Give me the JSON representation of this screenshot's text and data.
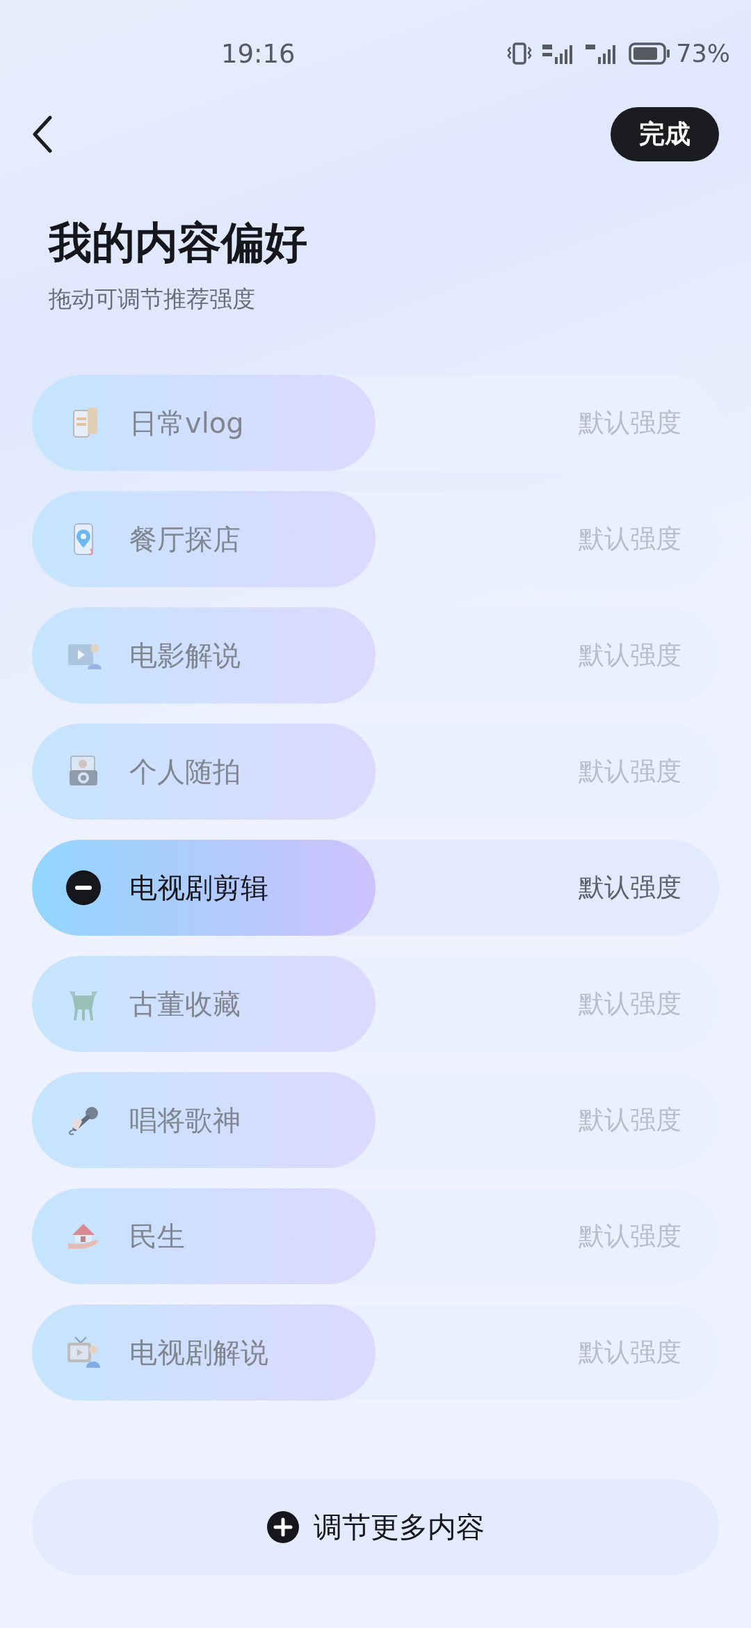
{
  "status_bar": {
    "time": "19:16",
    "battery": "73%"
  },
  "header": {
    "done_button": "完成"
  },
  "title": "我的内容偏好",
  "subtitle": "拖动可调节推荐强度",
  "items": [
    {
      "label": "日常vlog",
      "reading": "默认强度",
      "level": 0.5,
      "selected": false,
      "kind": "phone"
    },
    {
      "label": "餐厅探店",
      "reading": "默认强度",
      "level": 0.5,
      "selected": false,
      "kind": "pin"
    },
    {
      "label": "电影解说",
      "reading": "默认强度",
      "level": 0.5,
      "selected": false,
      "kind": "film"
    },
    {
      "label": "个人随拍",
      "reading": "默认强度",
      "level": 0.5,
      "selected": false,
      "kind": "camera"
    },
    {
      "label": "电视剧剪辑",
      "reading": "默认强度",
      "level": 0.5,
      "selected": true
    },
    {
      "label": "古董收藏",
      "reading": "默认强度",
      "level": 0.5,
      "selected": false,
      "kind": "vessel"
    },
    {
      "label": "唱将歌神",
      "reading": "默认强度",
      "level": 0.5,
      "selected": false,
      "kind": "mic"
    },
    {
      "label": "民生",
      "reading": "默认强度",
      "level": 0.5,
      "selected": false,
      "kind": "house"
    },
    {
      "label": "电视剧解说",
      "reading": "默认强度",
      "level": 0.5,
      "selected": false,
      "kind": "tv"
    }
  ],
  "more_button": "调节更多内容"
}
